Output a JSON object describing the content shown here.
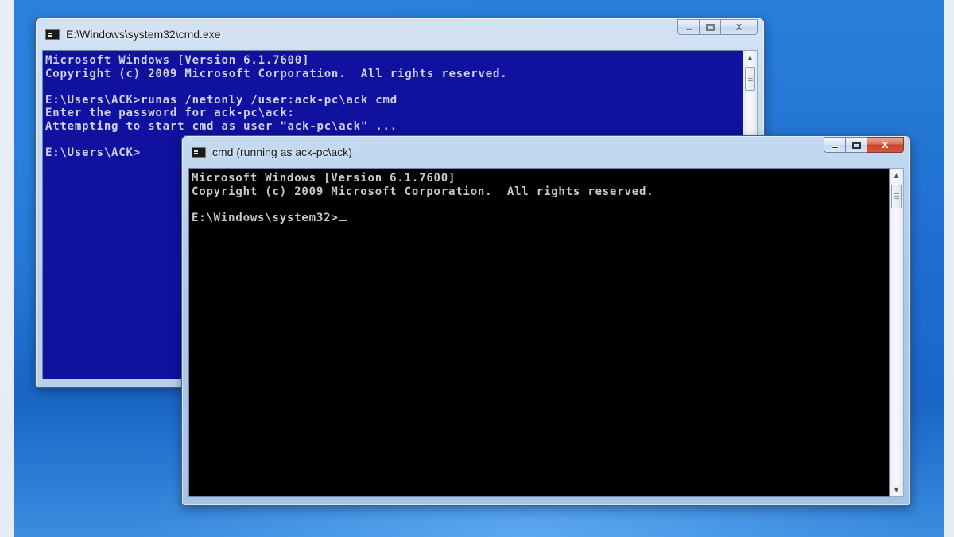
{
  "back_window": {
    "title": "E:\\Windows\\system32\\cmd.exe",
    "icon": "cmd-icon",
    "console_color": "#10119e",
    "lines": [
      "Microsoft Windows [Version 6.1.7600]",
      "Copyright (c) 2009 Microsoft Corporation.  All rights reserved.",
      "",
      "E:\\Users\\ACK>runas /netonly /user:ack-pc\\ack cmd",
      "Enter the password for ack-pc\\ack:",
      "Attempting to start cmd as user \"ack-pc\\ack\" ...",
      "",
      "E:\\Users\\ACK>"
    ]
  },
  "front_window": {
    "title": "cmd (running as ack-pc\\ack)",
    "icon": "cmd-icon",
    "console_color": "#000000",
    "lines": [
      "Microsoft Windows [Version 6.1.7600]",
      "Copyright (c) 2009 Microsoft Corporation.  All rights reserved.",
      ""
    ],
    "prompt": "E:\\Windows\\system32>"
  },
  "controls": {
    "minimize": "minimize-icon",
    "maximize": "maximize-icon",
    "close_label": "X"
  },
  "scrollbar": {
    "up_arrow": "▲",
    "down_arrow": "▼"
  }
}
